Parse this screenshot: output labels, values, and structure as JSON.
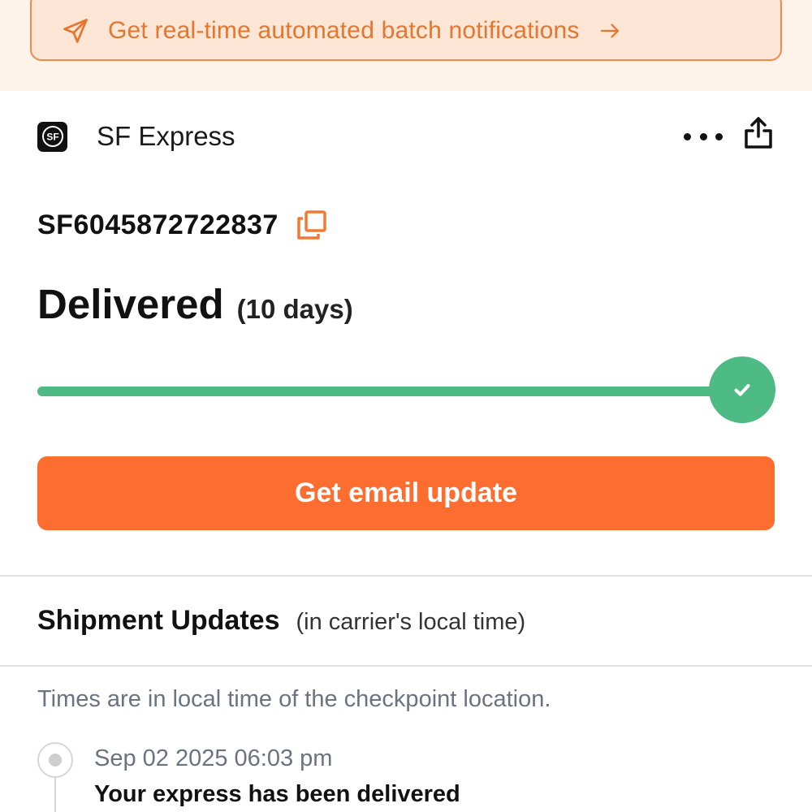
{
  "banner": {
    "text": "Get real-time automated batch notifications",
    "icon": "send-icon",
    "trailing_icon": "arrow-right-icon",
    "accent_color": "#e4762f"
  },
  "carrier": {
    "name": "SF Express",
    "logo_text": "SF",
    "more_icon": "more-horizontal-icon",
    "share_icon": "share-icon"
  },
  "tracking": {
    "number": "SF6045872722837",
    "copy_icon": "copy-icon"
  },
  "status": {
    "title": "Delivered",
    "duration": "(10 days)",
    "progress": 1.0,
    "progress_color": "#4dbb83"
  },
  "email_button": {
    "label": "Get email update",
    "color": "#fd6d30"
  },
  "updates": {
    "title": "Shipment Updates",
    "subtitle": "(in carrier's local time)",
    "note": "Times are in local time of the checkpoint location.",
    "events": [
      {
        "time": "Sep 02 2025 06:03 pm",
        "description": "Your express has been delivered"
      }
    ]
  }
}
